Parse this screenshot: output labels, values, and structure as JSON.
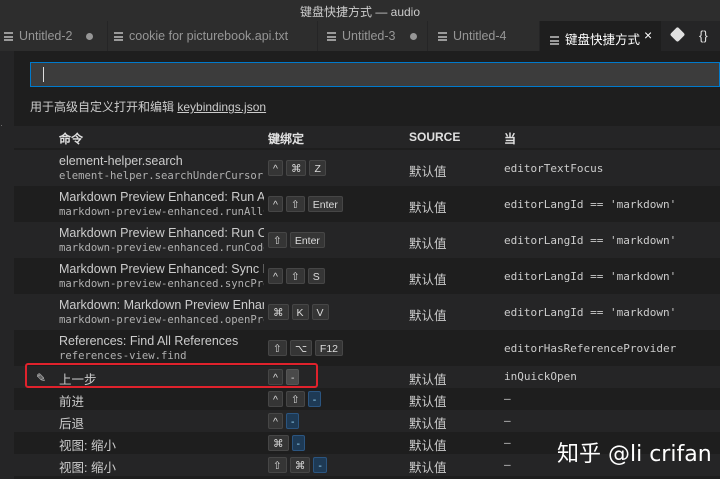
{
  "window": {
    "title": "键盘快捷方式 — audio"
  },
  "tabs": [
    {
      "label": "Untitled-2",
      "dirty": true
    },
    {
      "label": "cookie for picturebook.api.txt",
      "dirty": false
    },
    {
      "label": "Untitled-3",
      "dirty": true
    },
    {
      "label": "Untitled-4",
      "dirty": false
    },
    {
      "label": "键盘快捷方式",
      "active": true,
      "close": "×"
    }
  ],
  "toolbar": {
    "braces": "{}"
  },
  "search": {
    "value": "",
    "placeholder": ""
  },
  "hint": {
    "prefix": "用于高级自定义打开和编辑 ",
    "link": "keybindings.json"
  },
  "columns": {
    "command": "命令",
    "keybinding": "键绑定",
    "source": "SOURCE",
    "when": "当"
  },
  "rows": [
    {
      "cmd": "element-helper.search",
      "id": "element-helper.searchUnderCursor",
      "keys": [
        "^",
        "⌘",
        "Z"
      ],
      "src": "默认值",
      "when": "editorTextFocus"
    },
    {
      "cmd": "Markdown Preview Enhanced: Run All",
      "id": "markdown-preview-enhanced.runAllCodeChunks",
      "keys": [
        "^",
        "⇧",
        "Enter"
      ],
      "src": "默认值",
      "when": "editorLangId == 'markdown'"
    },
    {
      "cmd": "Markdown Preview Enhanced: Run Code Chunk",
      "id": "markdown-preview-enhanced.runCodeChunk",
      "keys": [
        "⇧",
        "Enter"
      ],
      "src": "默认值",
      "when": "editorLangId == 'markdown'"
    },
    {
      "cmd": "Markdown Preview Enhanced: Sync Preview",
      "id": "markdown-preview-enhanced.syncPreview",
      "keys": [
        "^",
        "⇧",
        "S"
      ],
      "src": "默认值",
      "when": "editorLangId == 'markdown'"
    },
    {
      "cmd": "Markdown: Markdown Preview Enhanced",
      "id": "markdown-preview-enhanced.openPreview",
      "keys": [
        "⌘",
        "K",
        "V"
      ],
      "src": "默认值",
      "when": "editorLangId == 'markdown'"
    },
    {
      "cmd": "References: Find All References",
      "id": "references-view.find",
      "keys": [
        "⇧",
        "⌥",
        "F12"
      ],
      "src": "",
      "when": "editorHasReferenceProvider"
    },
    {
      "cmd": "上一步",
      "keys": [
        "^",
        "-"
      ],
      "src": "默认值",
      "when": "inQuickOpen",
      "highlighted": true
    },
    {
      "cmd": "前进",
      "keys": [
        "^",
        "⇧",
        "-"
      ],
      "src": "默认值",
      "when": "—"
    },
    {
      "cmd": "后退",
      "keys": [
        "^",
        "-"
      ],
      "src": "默认值",
      "when": "—"
    },
    {
      "cmd": "视图: 缩小",
      "keys": [
        "⌘",
        "-"
      ],
      "src": "默认值",
      "when": "—"
    },
    {
      "cmd": "视图: 缩小",
      "keys": [
        "⇧",
        "⌘",
        "-"
      ],
      "src": "默认值",
      "when": "—"
    }
  ],
  "watermark": "知乎 @li crifan",
  "colors": {
    "accent": "#007acc",
    "highlight": "#e0222c",
    "background": "#1e1e1e"
  }
}
